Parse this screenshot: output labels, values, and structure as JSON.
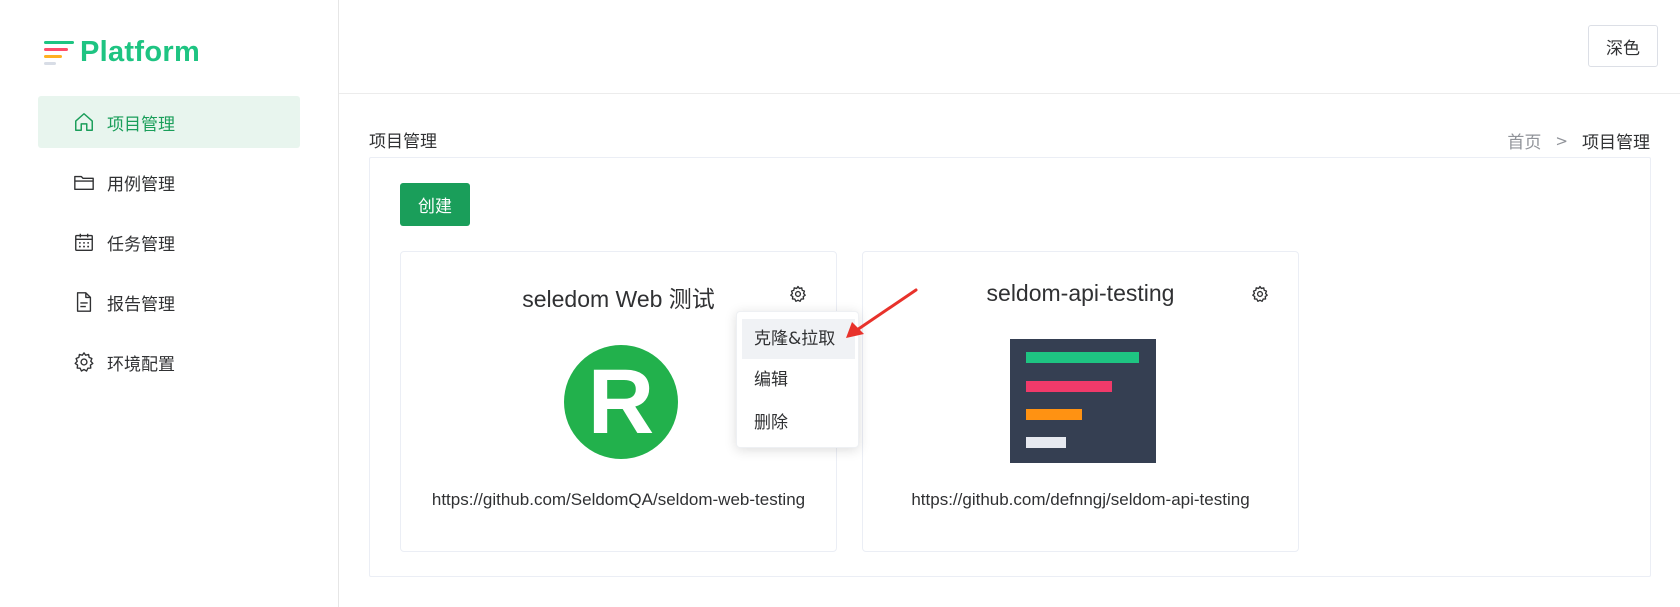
{
  "app": {
    "title": "Platform"
  },
  "sidebar": {
    "items": [
      {
        "label": "项目管理",
        "icon": "home-icon",
        "active": true
      },
      {
        "label": "用例管理",
        "icon": "folder-icon",
        "active": false
      },
      {
        "label": "任务管理",
        "icon": "calendar-icon",
        "active": false
      },
      {
        "label": "报告管理",
        "icon": "document-icon",
        "active": false
      },
      {
        "label": "环境配置",
        "icon": "gear-icon",
        "active": false
      }
    ]
  },
  "header": {
    "theme_button": "深色"
  },
  "page": {
    "title": "项目管理",
    "breadcrumb": {
      "home": "首页",
      "separator": ">",
      "current": "项目管理"
    },
    "create_button": "创建"
  },
  "projects": [
    {
      "name": "seledom Web 测试",
      "url": "https://github.com/SeldomQA/seldom-web-testing",
      "image": "R",
      "image_color": "#22b14c"
    },
    {
      "name": "seldom-api-testing",
      "url": "https://github.com/defnngj/seldom-api-testing",
      "image": "bars-thumbnail",
      "image_color": "#353f52"
    }
  ],
  "dropdown": {
    "items": [
      "克隆&拉取",
      "编辑",
      "删除"
    ]
  },
  "colors": {
    "brand": "#1ec482",
    "primary": "#1a9e5a",
    "annotation_arrow": "#e8322b"
  }
}
